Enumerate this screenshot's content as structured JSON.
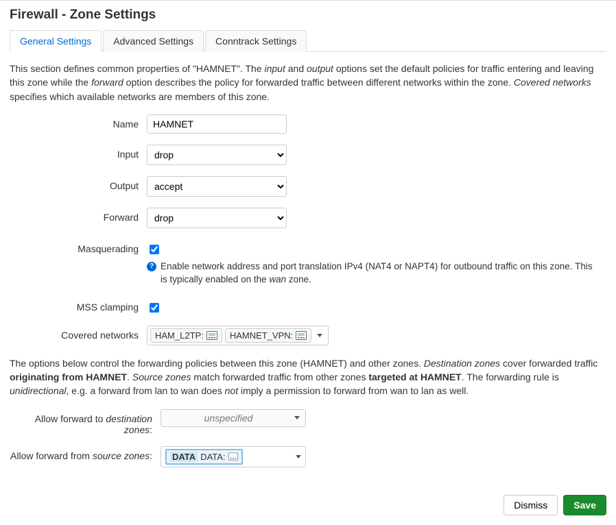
{
  "header": {
    "title": "Firewall - Zone Settings"
  },
  "tabs": {
    "general": "General Settings",
    "advanced": "Advanced Settings",
    "conntrack": "Conntrack Settings"
  },
  "intro": {
    "p1a": "This section defines common properties of \"HAMNET\". The ",
    "input": "input",
    "p1b": " and ",
    "output": "output",
    "p1c": " options set the default policies for traffic entering and leaving this zone while the ",
    "forward": "forward",
    "p1d": " option describes the policy for forwarded traffic between different networks within the zone. ",
    "covered": "Covered networks",
    "p1e": " specifies which available networks are members of this zone."
  },
  "labels": {
    "name": "Name",
    "input": "Input",
    "output": "Output",
    "forward": "Forward",
    "masq": "Masquerading",
    "mss": "MSS clamping",
    "covered": "Covered networks",
    "allow_to_a": "Allow forward to ",
    "allow_to_b": "destination zones",
    "allow_to_c": ":",
    "allow_from_a": "Allow forward from ",
    "allow_from_b": "source zones",
    "allow_from_c": ":"
  },
  "values": {
    "name": "HAMNET",
    "input": "drop",
    "output": "accept",
    "forward": "drop",
    "masq_checked": true,
    "mss_checked": true,
    "net1": "HAM_L2TP:",
    "net2": "HAMNET_VPN:",
    "dest_unspecified": "unspecified",
    "src_zone_name": "DATA",
    "src_zone_dev": "DATA:"
  },
  "masq_help": {
    "a": "Enable network address and port translation IPv4 (NAT4 or NAPT4) for outbound traffic on this zone. This is typically enabled on the ",
    "wan": "wan",
    "b": " zone."
  },
  "mid": {
    "a": "The options below control the forwarding policies between this zone (HAMNET) and other zones. ",
    "dz": "Destination zones",
    "b": " cover forwarded traffic ",
    "orig": "originating from HAMNET",
    "c": ". ",
    "sz": "Source zones",
    "d": " match forwarded traffic from other zones ",
    "target": "targeted at HAMNET",
    "e": ". The forwarding rule is ",
    "uni": "unidirectional",
    "f": ", e.g. a forward from lan to wan does ",
    "not": "not",
    "g": " imply a permission to forward from wan to lan as well."
  },
  "buttons": {
    "dismiss": "Dismiss",
    "save": "Save"
  }
}
